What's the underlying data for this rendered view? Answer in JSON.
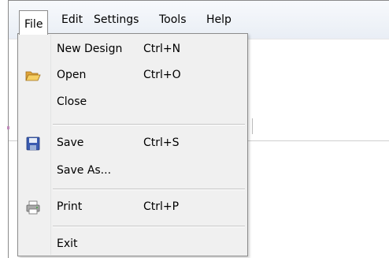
{
  "menubar": {
    "items": [
      "File",
      "Edit",
      "Settings",
      "Tools",
      "Help"
    ]
  },
  "file_menu": {
    "items": [
      {
        "label": "New Design",
        "shortcut": "Ctrl+N",
        "icon": ""
      },
      {
        "label": "Open",
        "shortcut": "Ctrl+O",
        "icon": "folder-open-icon"
      },
      {
        "label": "Close",
        "shortcut": "",
        "icon": ""
      },
      {
        "label": "Save",
        "shortcut": "Ctrl+S",
        "icon": "floppy-disk-icon"
      },
      {
        "label": "Save As...",
        "shortcut": "",
        "icon": ""
      },
      {
        "label": "Print",
        "shortcut": "Ctrl+P",
        "icon": "printer-icon"
      },
      {
        "label": "Exit",
        "shortcut": "",
        "icon": ""
      }
    ]
  }
}
